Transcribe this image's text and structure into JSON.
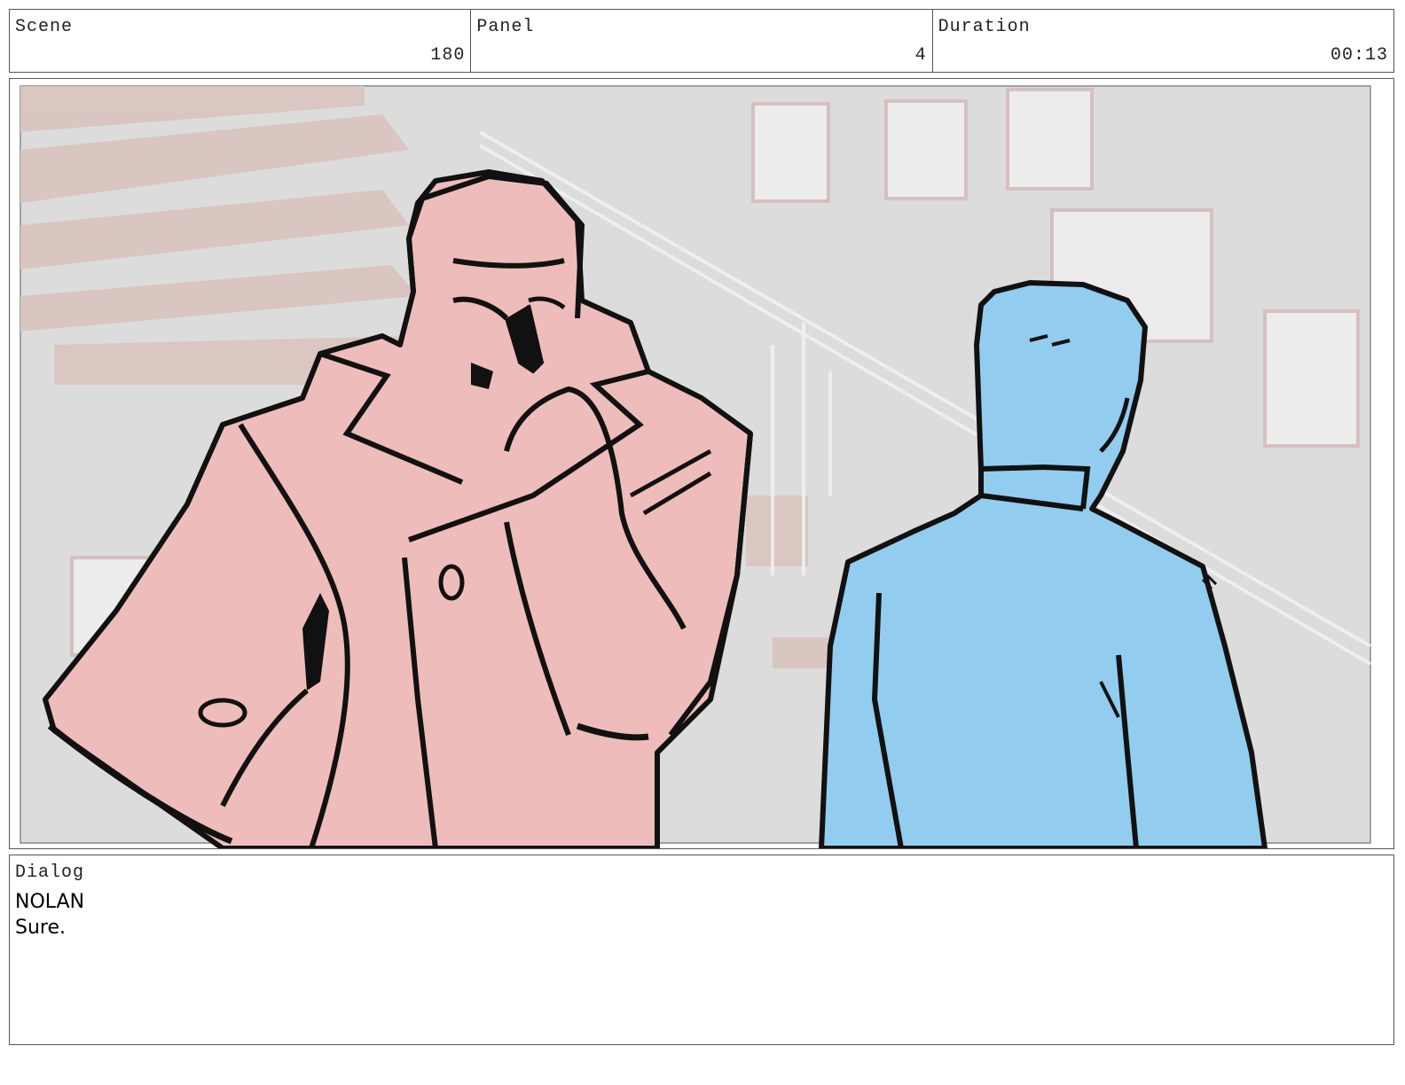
{
  "header": {
    "scene_label": "Scene",
    "scene_value": "180",
    "panel_label": "Panel",
    "panel_value": "4",
    "duration_label": "Duration",
    "duration_value": "00:13"
  },
  "dialog": {
    "label": "Dialog",
    "speaker": "NOLAN",
    "line": "Sure."
  },
  "colors": {
    "left_figure_fill": "#efbcbc",
    "right_figure_fill": "#92cdf0",
    "background_wall": "#dcdcdc",
    "stair_steps": "#d9c3bc"
  }
}
